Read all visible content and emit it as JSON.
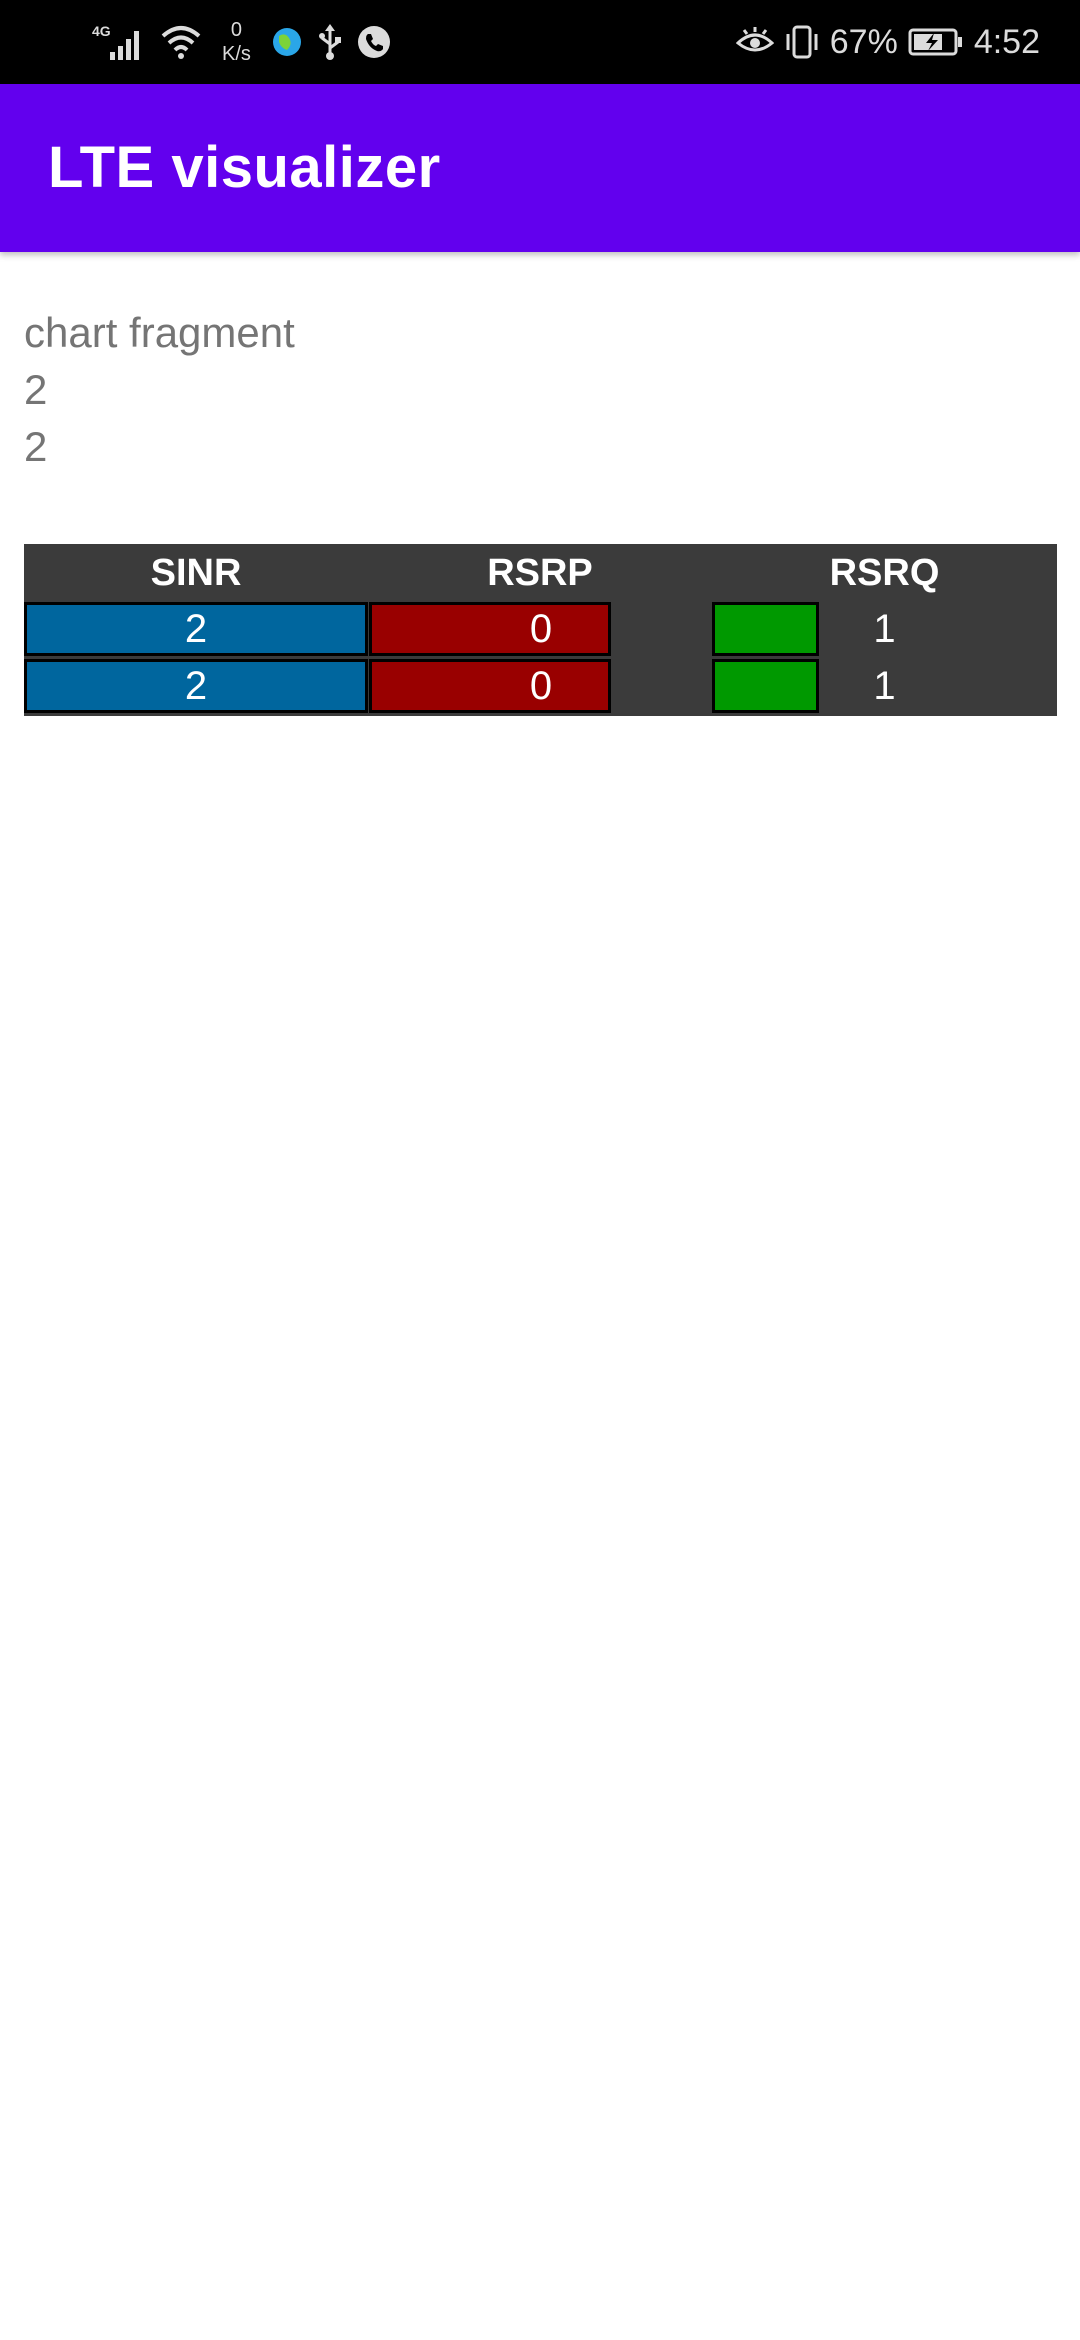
{
  "status_bar": {
    "network_type": "4G",
    "net_speed_value": "0",
    "net_speed_unit": "K/s",
    "battery_percent": "67%",
    "time": "4:52",
    "icons": [
      "signal-icon",
      "wifi-icon",
      "app-globe-icon",
      "usb-icon",
      "call-icon",
      "eye-comfort-icon",
      "vibrate-icon",
      "battery-icon"
    ]
  },
  "app_bar": {
    "title": "LTE visualizer",
    "color": "#6200ee"
  },
  "content": {
    "fragment_label": "chart fragment",
    "lines": [
      "2",
      "2"
    ]
  },
  "table": {
    "headers": [
      "SINR",
      "RSRP",
      "RSRQ"
    ],
    "rows": [
      {
        "sinr": "2",
        "rsrp": "0",
        "rsrq": "1"
      },
      {
        "sinr": "2",
        "rsrp": "0",
        "rsrq": "1"
      }
    ],
    "colors": {
      "background": "#3b3b3b",
      "sinr": "#00669e",
      "rsrp": "#990000",
      "rsrq": "#009900"
    }
  }
}
